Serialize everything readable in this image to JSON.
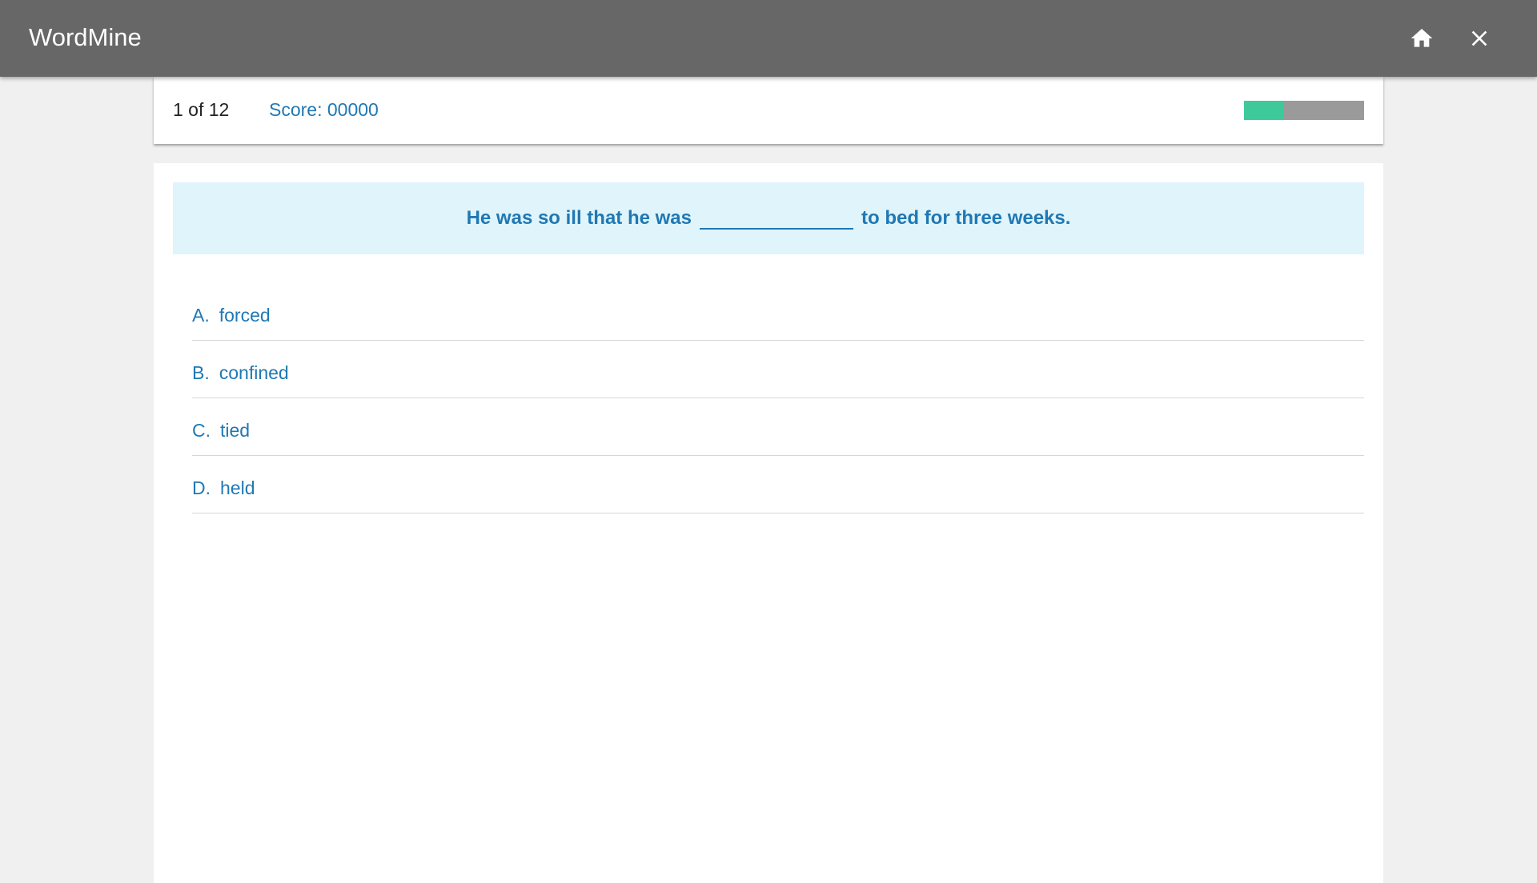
{
  "app": {
    "title": "WordMine",
    "icons": {
      "home": "home-icon",
      "close": "close-icon"
    }
  },
  "status": {
    "counter": "1 of 12",
    "score": "Score: 00000",
    "progress": 0.33
  },
  "question": {
    "before_blank": "He was so ill that he was",
    "after_blank": "to bed for three weeks."
  },
  "options": [
    {
      "letter": "A.",
      "text": "forced"
    },
    {
      "letter": "B.",
      "text": "confined"
    },
    {
      "letter": "C.",
      "text": "tied"
    },
    {
      "letter": "D.",
      "text": "held"
    }
  ],
  "colors": {
    "appbar": "#676767",
    "accent": "#1f78b4",
    "progress_fill": "#3ec99b",
    "progress_track": "#9a9a9a",
    "prompt_bg": "#e0f4fb",
    "page_bg": "#f0f0f0"
  }
}
